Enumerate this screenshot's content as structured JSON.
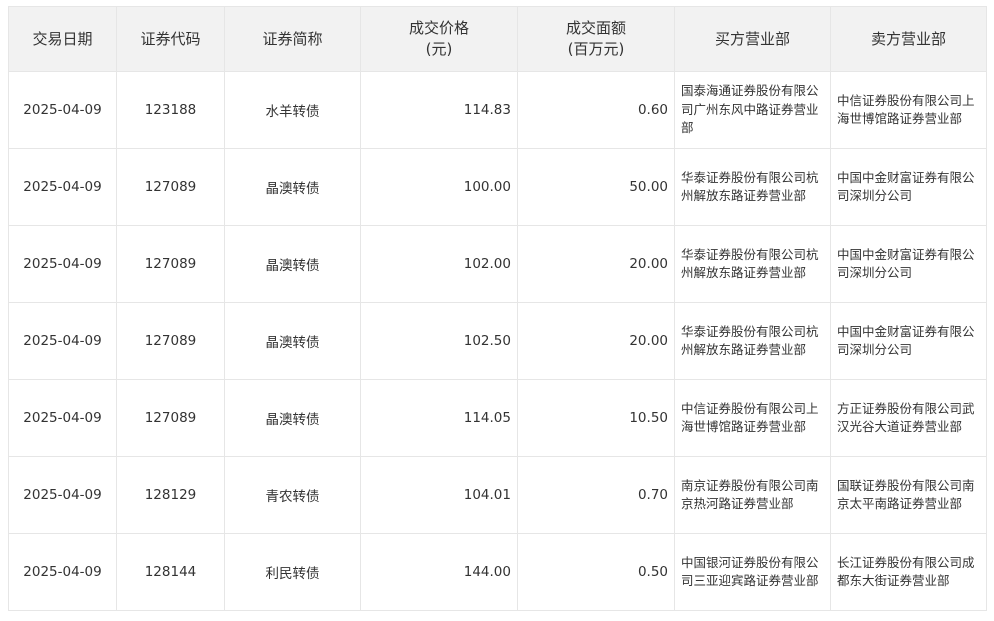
{
  "table": {
    "headers": {
      "date": "交易日期",
      "code": "证券代码",
      "name": "证券简称",
      "price_1": "成交价格",
      "price_2": "(元)",
      "amount_1": "成交面额",
      "amount_2": "(百万元)",
      "buyer": "买方营业部",
      "seller": "卖方营业部"
    },
    "rows": [
      {
        "date": "2025-04-09",
        "code": "123188",
        "name": "水羊转债",
        "price": "114.83",
        "amount": "0.60",
        "buyer": "国泰海通证券股份有限公司广州东风中路证券营业部",
        "seller": "中信证券股份有限公司上海世博馆路证券营业部"
      },
      {
        "date": "2025-04-09",
        "code": "127089",
        "name": "晶澳转债",
        "price": "100.00",
        "amount": "50.00",
        "buyer": "华泰证券股份有限公司杭州解放东路证券营业部",
        "seller": "中国中金财富证券有限公司深圳分公司"
      },
      {
        "date": "2025-04-09",
        "code": "127089",
        "name": "晶澳转债",
        "price": "102.00",
        "amount": "20.00",
        "buyer": "华泰证券股份有限公司杭州解放东路证券营业部",
        "seller": "中国中金财富证券有限公司深圳分公司"
      },
      {
        "date": "2025-04-09",
        "code": "127089",
        "name": "晶澳转债",
        "price": "102.50",
        "amount": "20.00",
        "buyer": "华泰证券股份有限公司杭州解放东路证券营业部",
        "seller": "中国中金财富证券有限公司深圳分公司"
      },
      {
        "date": "2025-04-09",
        "code": "127089",
        "name": "晶澳转债",
        "price": "114.05",
        "amount": "10.50",
        "buyer": "中信证券股份有限公司上海世博馆路证券营业部",
        "seller": "方正证券股份有限公司武汉光谷大道证券营业部"
      },
      {
        "date": "2025-04-09",
        "code": "128129",
        "name": "青农转债",
        "price": "104.01",
        "amount": "0.70",
        "buyer": "南京证券股份有限公司南京热河路证券营业部",
        "seller": "国联证券股份有限公司南京太平南路证券营业部"
      },
      {
        "date": "2025-04-09",
        "code": "128144",
        "name": "利民转债",
        "price": "144.00",
        "amount": "0.50",
        "buyer": "中国银河证券股份有限公司三亚迎宾路证券营业部",
        "seller": "长江证券股份有限公司成都东大街证券营业部"
      }
    ]
  }
}
